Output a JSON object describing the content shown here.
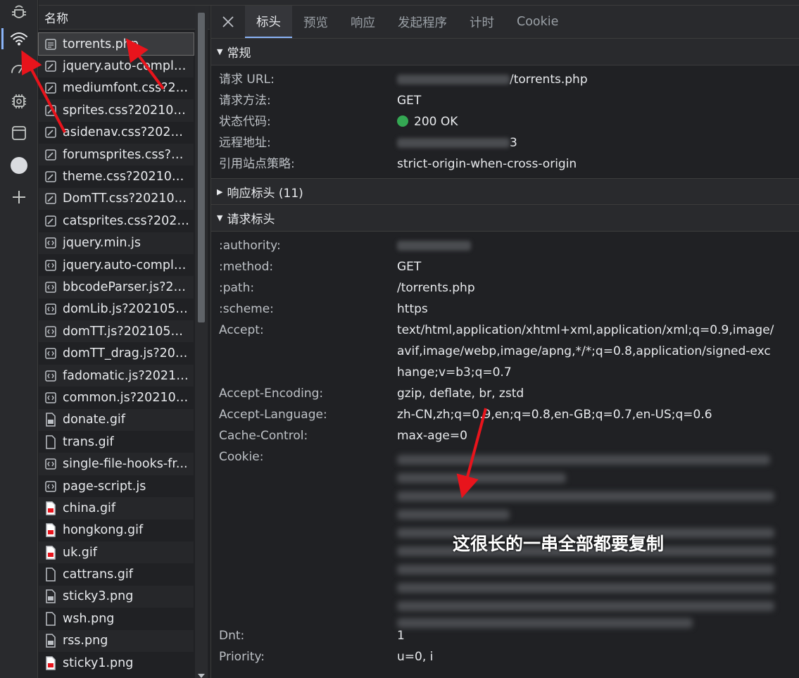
{
  "filelist": {
    "header": "名称",
    "rows": [
      {
        "name": "torrents.php",
        "type": "doc"
      },
      {
        "name": "jquery.auto-comple...",
        "type": "css"
      },
      {
        "name": "mediumfont.css?20...",
        "type": "css"
      },
      {
        "name": "sprites.css?202105...",
        "type": "css"
      },
      {
        "name": "asidenav.css?20210...",
        "type": "css"
      },
      {
        "name": "forumsprites.css?2...",
        "type": "css"
      },
      {
        "name": "theme.css?2021052...",
        "type": "css"
      },
      {
        "name": "DomTT.css?202105...",
        "type": "css"
      },
      {
        "name": "catsprites.css?2021...",
        "type": "css"
      },
      {
        "name": "jquery.min.js",
        "type": "js"
      },
      {
        "name": "jquery.auto-comple...",
        "type": "js"
      },
      {
        "name": "bbcodeParser.js?20...",
        "type": "js"
      },
      {
        "name": "domLib.js?2021052...",
        "type": "js"
      },
      {
        "name": "domTT.js?2021052...",
        "type": "js"
      },
      {
        "name": "domTT_drag.js?202...",
        "type": "js"
      },
      {
        "name": "fadomatic.js?20210...",
        "type": "js"
      },
      {
        "name": "common.js?202105...",
        "type": "js"
      },
      {
        "name": "donate.gif",
        "type": "img"
      },
      {
        "name": "trans.gif",
        "type": "blank"
      },
      {
        "name": "single-file-hooks-fr...",
        "type": "js"
      },
      {
        "name": "page-script.js",
        "type": "js"
      },
      {
        "name": "china.gif",
        "type": "img-red"
      },
      {
        "name": "hongkong.gif",
        "type": "img-red"
      },
      {
        "name": "uk.gif",
        "type": "img-red"
      },
      {
        "name": "cattrans.gif",
        "type": "blank"
      },
      {
        "name": "sticky3.png",
        "type": "img"
      },
      {
        "name": "wsh.png",
        "type": "blank"
      },
      {
        "name": "rss.png",
        "type": "img"
      },
      {
        "name": "sticky1.png",
        "type": "img-red"
      }
    ]
  },
  "tabs": [
    "标头",
    "预览",
    "响应",
    "发起程序",
    "计时",
    "Cookie"
  ],
  "general": {
    "title": "常规",
    "rows": [
      {
        "k": "请求 URL:",
        "v": "/torrents.php",
        "blurPrefix": true
      },
      {
        "k": "请求方法:",
        "v": "GET"
      },
      {
        "k": "状态代码:",
        "v": "200 OK",
        "status": true
      },
      {
        "k": "远程地址:",
        "v": "3",
        "blurPrefix": true
      },
      {
        "k": "引用站点策略:",
        "v": "strict-origin-when-cross-origin"
      }
    ]
  },
  "response_headers": {
    "title": "响应标头 (11)"
  },
  "request_headers": {
    "title": "请求标头",
    "rows": [
      {
        "k": ":authority:",
        "v": "",
        "blurOnly": true
      },
      {
        "k": ":method:",
        "v": "GET"
      },
      {
        "k": ":path:",
        "v": "/torrents.php"
      },
      {
        "k": ":scheme:",
        "v": "https"
      },
      {
        "k": "Accept:",
        "v": "text/html,application/xhtml+xml,application/xml;q=0.9,image/avif,image/webp,image/apng,*/*;q=0.8,application/signed-exchange;v=b3;q=0.7"
      },
      {
        "k": "Accept-Encoding:",
        "v": "gzip, deflate, br, zstd"
      },
      {
        "k": "Accept-Language:",
        "v": "zh-CN,zh;q=0.9,en;q=0.8,en-GB;q=0.7,en-US;q=0.6"
      },
      {
        "k": "Cache-Control:",
        "v": "max-age=0"
      }
    ],
    "cookie_key": "Cookie:",
    "after": [
      {
        "k": "Dnt:",
        "v": "1"
      },
      {
        "k": "Priority:",
        "v": "u=0, i"
      }
    ]
  },
  "annotation": "这很长的一串全部都要复制",
  "colors": {
    "accent": "#8ab4f8",
    "annotation_arrow": "#e8141c",
    "status_ok": "#34a853"
  }
}
